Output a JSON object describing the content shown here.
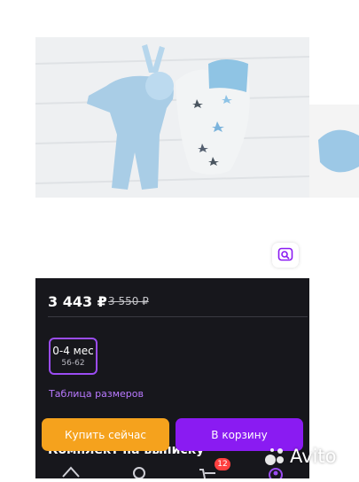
{
  "listing": {
    "price": "3 443 ₽",
    "old_price": "3 550 ₽",
    "size": {
      "label": "0-4 мес",
      "sub": "56-62"
    },
    "size_table_link": "Таблица размеров",
    "title": "Комплект на выписку"
  },
  "actions": {
    "buy_now": "Купить сейчас",
    "add_to_cart": "В корзину"
  },
  "bottom_nav": {
    "cart_badge": "12",
    "items": [
      "home-icon",
      "search-icon",
      "cart-icon",
      "profile-icon"
    ]
  },
  "watermark": {
    "text": "Avito"
  },
  "colors": {
    "panel": "#17171c",
    "buy": "#f5a21d",
    "cart": "#8a1bf2",
    "link": "#b979ff",
    "badge": "#ff4040"
  }
}
